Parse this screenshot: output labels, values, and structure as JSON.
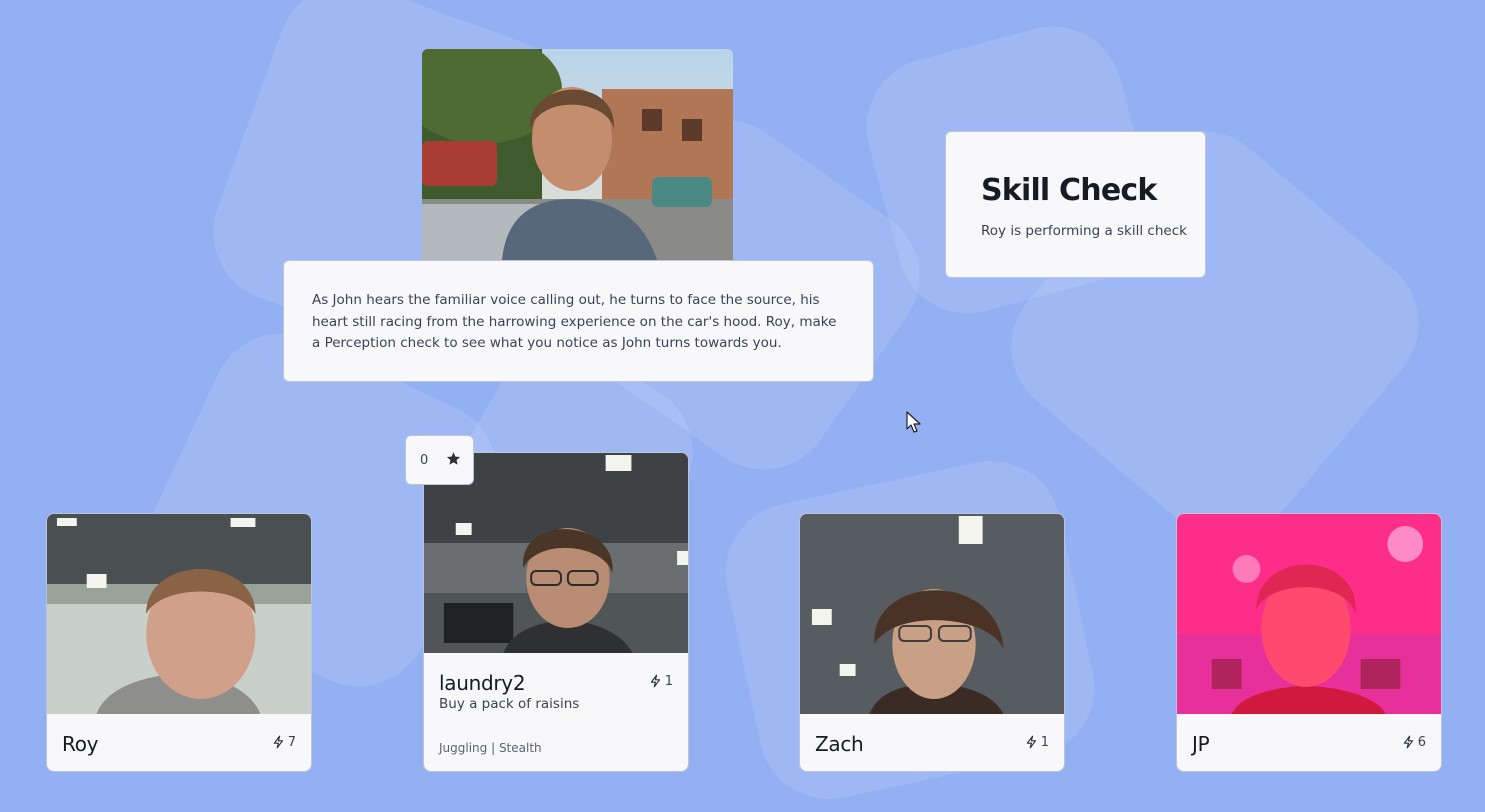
{
  "narrator": {
    "portrait": "narrator-portrait-john",
    "text": "As John hears the familiar voice calling out, he turns to face the source, his heart still racing from the harrowing experience on the car's hood. Roy, make a Perception check to see what you notice as John turns towards you."
  },
  "skill_check": {
    "title": "Skill Check",
    "subtitle": "Roy is performing a skill check"
  },
  "star_badge": {
    "count": "0",
    "icon": "star-icon"
  },
  "players": [
    {
      "name": "Roy",
      "energy": "7",
      "energy_icon": "lightning-icon"
    },
    {
      "name": "laundry2",
      "energy": "1",
      "energy_icon": "lightning-icon",
      "goal": "Buy a pack of raisins",
      "skills": "Juggling | Stealth"
    },
    {
      "name": "Zach",
      "energy": "1",
      "energy_icon": "lightning-icon"
    },
    {
      "name": "JP",
      "energy": "6",
      "energy_icon": "lightning-icon"
    }
  ],
  "colors": {
    "background": "#92b0f2",
    "card": "#f8f8fb",
    "text_dark": "#161b24",
    "text_body": "#3a4352"
  }
}
